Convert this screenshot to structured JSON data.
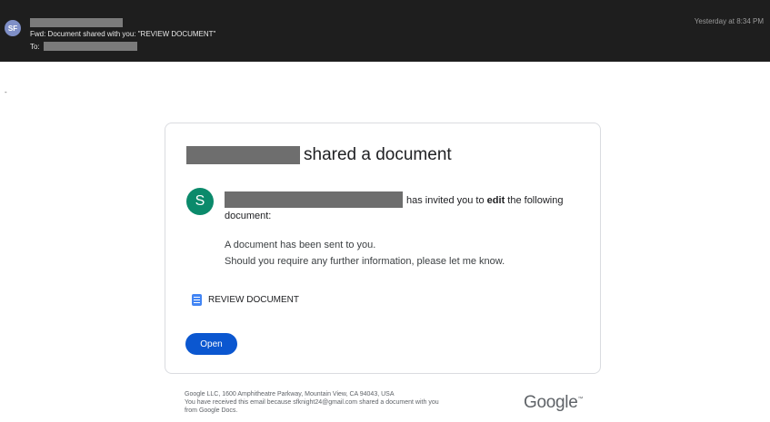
{
  "header": {
    "avatar_initials": "SF",
    "subject": "Fwd: Document shared with you: \"REVIEW DOCUMENT\"",
    "to_label": "To:",
    "timestamp": "Yesterday at 8:34 PM"
  },
  "separator": "-",
  "card": {
    "title_suffix": "shared a document",
    "avatar_initial": "S",
    "invite_text_before": "has invited you to ",
    "invite_text_bold": "edit",
    "invite_text_after": " the following",
    "invite_text_line2": "document:",
    "message_line1": "A document has been sent to you.",
    "message_line2": "Should you require any further information, please let me know.",
    "document_name": "REVIEW DOCUMENT",
    "open_button": "Open"
  },
  "footer": {
    "line1": "Google LLC, 1600 Amphitheatre Parkway, Mountain View, CA 94043, USA",
    "line2": "You have received this email because sfknight24@gmail.com shared a document with you",
    "line3": "from Google Docs.",
    "logo_text": "Google",
    "logo_tm": "™"
  },
  "colors": {
    "header_bg": "#1e1e1e",
    "avatar_s": "#0b8a6b",
    "button": "#0b57d0",
    "doc_icon": "#4285f4"
  }
}
